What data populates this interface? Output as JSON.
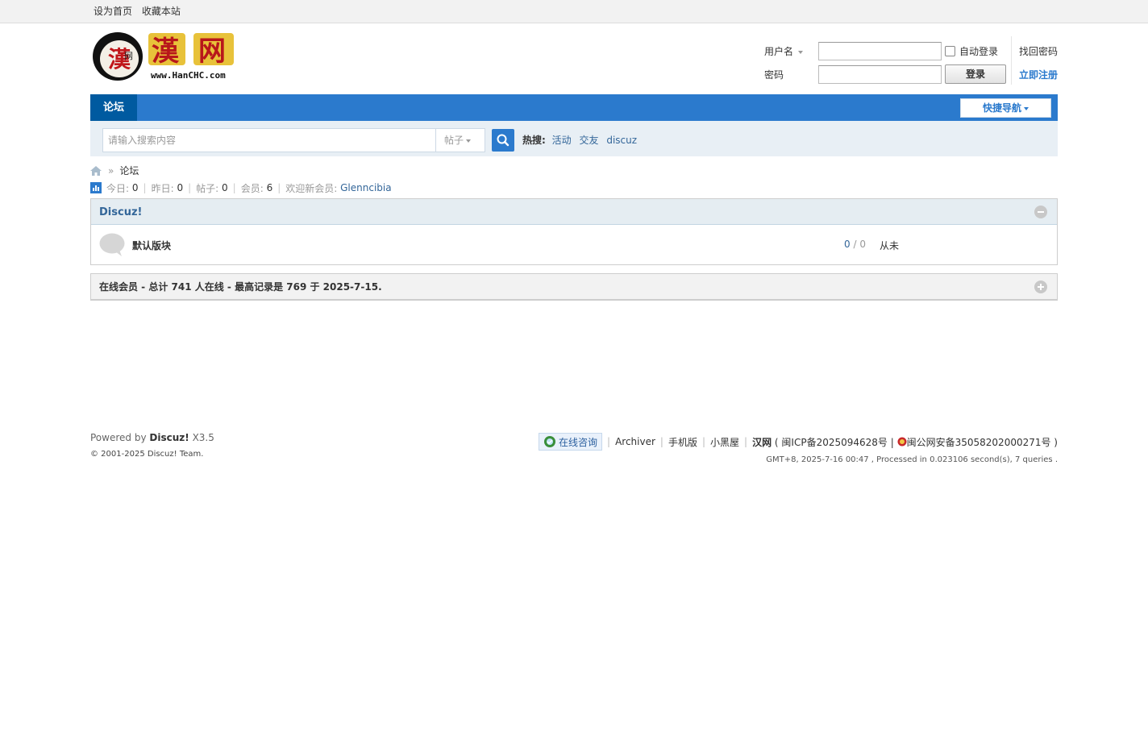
{
  "topbar": {
    "set_home": "设为首页",
    "bookmark": "收藏本站"
  },
  "logo": {
    "url_text": "www.HanCHC.com",
    "glyph": "漢"
  },
  "login": {
    "username_label": "用户名",
    "password_label": "密码",
    "auto_login": "自动登录",
    "login_button": "登录",
    "forgot_password": "找回密码",
    "register": "立即注册"
  },
  "nav": {
    "forum": "论坛",
    "quick_nav": "快捷导航"
  },
  "search": {
    "placeholder": "请输入搜索内容",
    "type": "帖子",
    "hot_label": "热搜:",
    "hot_terms": [
      "活动",
      "交友",
      "discuz"
    ]
  },
  "breadcrumb": {
    "current": "论坛"
  },
  "stats": {
    "today_label": "今日:",
    "today": "0",
    "yesterday_label": "昨日:",
    "yesterday": "0",
    "posts_label": "帖子:",
    "posts": "0",
    "members_label": "会员:",
    "members": "6",
    "welcome_label": "欢迎新会员:",
    "newest_member": "Glenncibia"
  },
  "category": {
    "title": "Discuz!",
    "forums": [
      {
        "name": "默认版块",
        "threads": "0",
        "posts": "0",
        "last": "从未"
      }
    ]
  },
  "online": {
    "text": "在线会员 - 总计 741 人在线 - 最高记录是 769 于 2025-7-15."
  },
  "footer": {
    "powered_prefix": "Powered by",
    "powered_brand": "Discuz!",
    "version": "X3.5",
    "copyright": "© 2001-2025 Discuz! Team.",
    "consult": "在线咨询",
    "archiver": "Archiver",
    "mobile": "手机版",
    "blackroom": "小黑屋",
    "site": "汉网",
    "icp": "( 闽ICP备2025094628号 |",
    "police": "闽公网安备35058202000271号 )",
    "meta": "GMT+8, 2025-7-16 00:47 , Processed in 0.023106 second(s), 7 queries ."
  },
  "colors": {
    "nav": "#2b7acd",
    "nav_active": "#005aa0",
    "search_bg": "#e8eff5",
    "link": "#336699"
  }
}
